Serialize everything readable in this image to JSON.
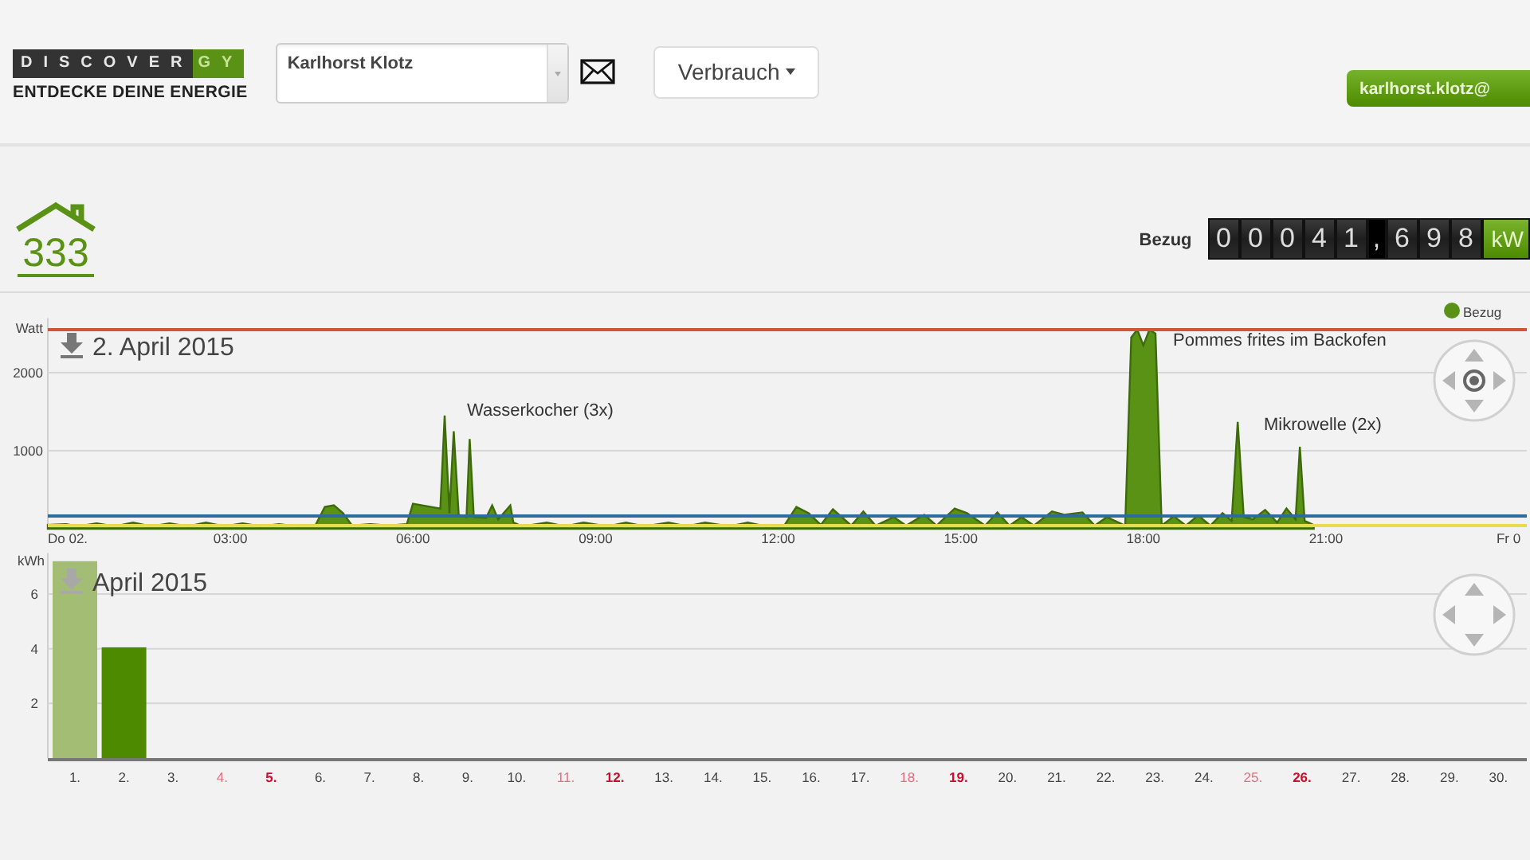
{
  "header": {
    "logo": {
      "wordmark": "DISCOVER",
      "wordmark_accent": "GY",
      "tagline": "ENTDECKE DEINE ENERGIE"
    },
    "meter_select": {
      "value": "Karlhorst Klotz"
    },
    "view_button": {
      "label": "Verbrauch"
    },
    "user_button": {
      "label": "karlhorst.klotz@"
    }
  },
  "summary": {
    "house_number": "333",
    "meter_label": "Bezug",
    "counter": "0 0 0 4 1 , 6 9 8",
    "counter_unit": "kW"
  },
  "day_chart": {
    "title": "2. April 2015",
    "download_disabled": false,
    "navigator": {
      "center_button": true
    },
    "chart_data": {
      "type": "area",
      "ylabel": "Watt",
      "xlim": [
        0,
        24.3
      ],
      "ylim": [
        0,
        2700
      ],
      "grid": true,
      "xticks": [
        {
          "value": 0,
          "label": "Do 02."
        },
        {
          "value": 3,
          "label": "03:00"
        },
        {
          "value": 6,
          "label": "06:00"
        },
        {
          "value": 9,
          "label": "09:00"
        },
        {
          "value": 12,
          "label": "12:00"
        },
        {
          "value": 15,
          "label": "15:00"
        },
        {
          "value": 18,
          "label": "18:00"
        },
        {
          "value": 21,
          "label": "21:00"
        },
        {
          "value": 24,
          "label": "Fr 0"
        }
      ],
      "yticks": [
        1000,
        2000
      ],
      "x": [
        0,
        0.3,
        0.5,
        0.8,
        1.1,
        1.4,
        1.7,
        2,
        2.3,
        2.6,
        2.9,
        3.2,
        3.5,
        3.8,
        4.1,
        4.4,
        4.55,
        4.7,
        4.85,
        5.0,
        5.3,
        5.6,
        5.9,
        6.0,
        6.3,
        6.45,
        6.52,
        6.6,
        6.67,
        6.75,
        6.88,
        6.93,
        7.0,
        7.2,
        7.3,
        7.4,
        7.6,
        7.65,
        7.8,
        8.2,
        8.5,
        8.8,
        9.2,
        9.5,
        9.8,
        10.2,
        10.5,
        10.8,
        11.2,
        11.5,
        11.8,
        12.1,
        12.3,
        12.5,
        12.7,
        12.9,
        13.2,
        13.4,
        13.6,
        13.9,
        14.1,
        14.4,
        14.6,
        14.9,
        15.1,
        15.4,
        15.6,
        15.8,
        16.0,
        16.2,
        16.5,
        16.7,
        17.0,
        17.2,
        17.4,
        17.7,
        17.8,
        17.9,
        18.0,
        18.1,
        18.2,
        18.3,
        18.5,
        18.7,
        18.9,
        19.1,
        19.3,
        19.45,
        19.55,
        19.65,
        19.8,
        20.0,
        20.2,
        20.35,
        20.5,
        20.57,
        20.65,
        20.8
      ],
      "series": [
        {
          "name": "Bezug",
          "color": "#5a9216",
          "values": [
            50,
            60,
            30,
            70,
            30,
            80,
            30,
            70,
            30,
            80,
            30,
            70,
            30,
            60,
            30,
            50,
            280,
            300,
            200,
            40,
            60,
            40,
            60,
            320,
            280,
            260,
            1450,
            200,
            1250,
            180,
            150,
            1150,
            150,
            140,
            300,
            120,
            300,
            80,
            30,
            80,
            30,
            80,
            30,
            80,
            30,
            80,
            30,
            80,
            30,
            80,
            30,
            40,
            280,
            200,
            50,
            250,
            40,
            220,
            40,
            150,
            40,
            180,
            40,
            260,
            200,
            40,
            210,
            40,
            150,
            40,
            220,
            180,
            210,
            40,
            150,
            40,
            2450,
            2550,
            2350,
            2550,
            2500,
            40,
            160,
            40,
            170,
            40,
            200,
            100,
            1370,
            150,
            120,
            240,
            80,
            260,
            120,
            1050,
            100,
            50
          ]
        }
      ],
      "annotations": [
        "Wasserkocher (3x)",
        "Pommes frites im Backofen",
        "Mikrowelle (2x)"
      ]
    }
  },
  "month_chart": {
    "title": "April 2015",
    "download_disabled": true,
    "navigator": {
      "center_button": false
    },
    "bars": [
      {
        "color": "#a3bd74"
      },
      {
        "color": "#4e8a00"
      }
    ],
    "day_labels": [
      {
        "color": "#444444",
        "bold": false
      },
      {
        "color": "#444444",
        "bold": false
      },
      {
        "color": "#444444",
        "bold": false
      },
      {
        "color": "#e2707f",
        "bold": false
      },
      {
        "color": "#c8102e",
        "bold": true
      },
      {
        "color": "#444444",
        "bold": false
      },
      {
        "color": "#444444",
        "bold": false
      },
      {
        "color": "#444444",
        "bold": false
      },
      {
        "color": "#444444",
        "bold": false
      },
      {
        "color": "#444444",
        "bold": false
      },
      {
        "color": "#e2707f",
        "bold": false
      },
      {
        "color": "#c8102e",
        "bold": true
      },
      {
        "color": "#444444",
        "bold": false
      },
      {
        "color": "#444444",
        "bold": false
      },
      {
        "color": "#444444",
        "bold": false
      },
      {
        "color": "#444444",
        "bold": false
      },
      {
        "color": "#444444",
        "bold": false
      },
      {
        "color": "#e2707f",
        "bold": false
      },
      {
        "color": "#c8102e",
        "bold": true
      },
      {
        "color": "#444444",
        "bold": false
      },
      {
        "color": "#444444",
        "bold": false
      },
      {
        "color": "#444444",
        "bold": false
      },
      {
        "color": "#444444",
        "bold": false
      },
      {
        "color": "#444444",
        "bold": false
      },
      {
        "color": "#e2707f",
        "bold": false
      },
      {
        "color": "#c8102e",
        "bold": true
      },
      {
        "color": "#444444",
        "bold": false
      },
      {
        "color": "#444444",
        "bold": false
      },
      {
        "color": "#444444",
        "bold": false
      },
      {
        "color": "#444444",
        "bold": false
      }
    ],
    "chart_data": {
      "type": "bar",
      "ylabel": "kWh",
      "ylim": [
        0,
        7.5
      ],
      "yticks": [
        2,
        4,
        6
      ],
      "grid": true,
      "categories": [
        "1.",
        "2.",
        "3.",
        "4.",
        "5.",
        "6.",
        "7.",
        "8.",
        "9.",
        "10.",
        "11.",
        "12.",
        "13.",
        "14.",
        "15.",
        "16.",
        "17.",
        "18.",
        "19.",
        "20.",
        "21.",
        "22.",
        "23.",
        "24.",
        "25.",
        "26.",
        "27.",
        "28.",
        "29.",
        "30."
      ],
      "values": [
        7.2,
        4.05,
        null,
        null,
        null,
        null,
        null,
        null,
        null,
        null,
        null,
        null,
        null,
        null,
        null,
        null,
        null,
        null,
        null,
        null,
        null,
        null,
        null,
        null,
        null,
        null,
        null,
        null,
        null,
        null
      ]
    }
  }
}
